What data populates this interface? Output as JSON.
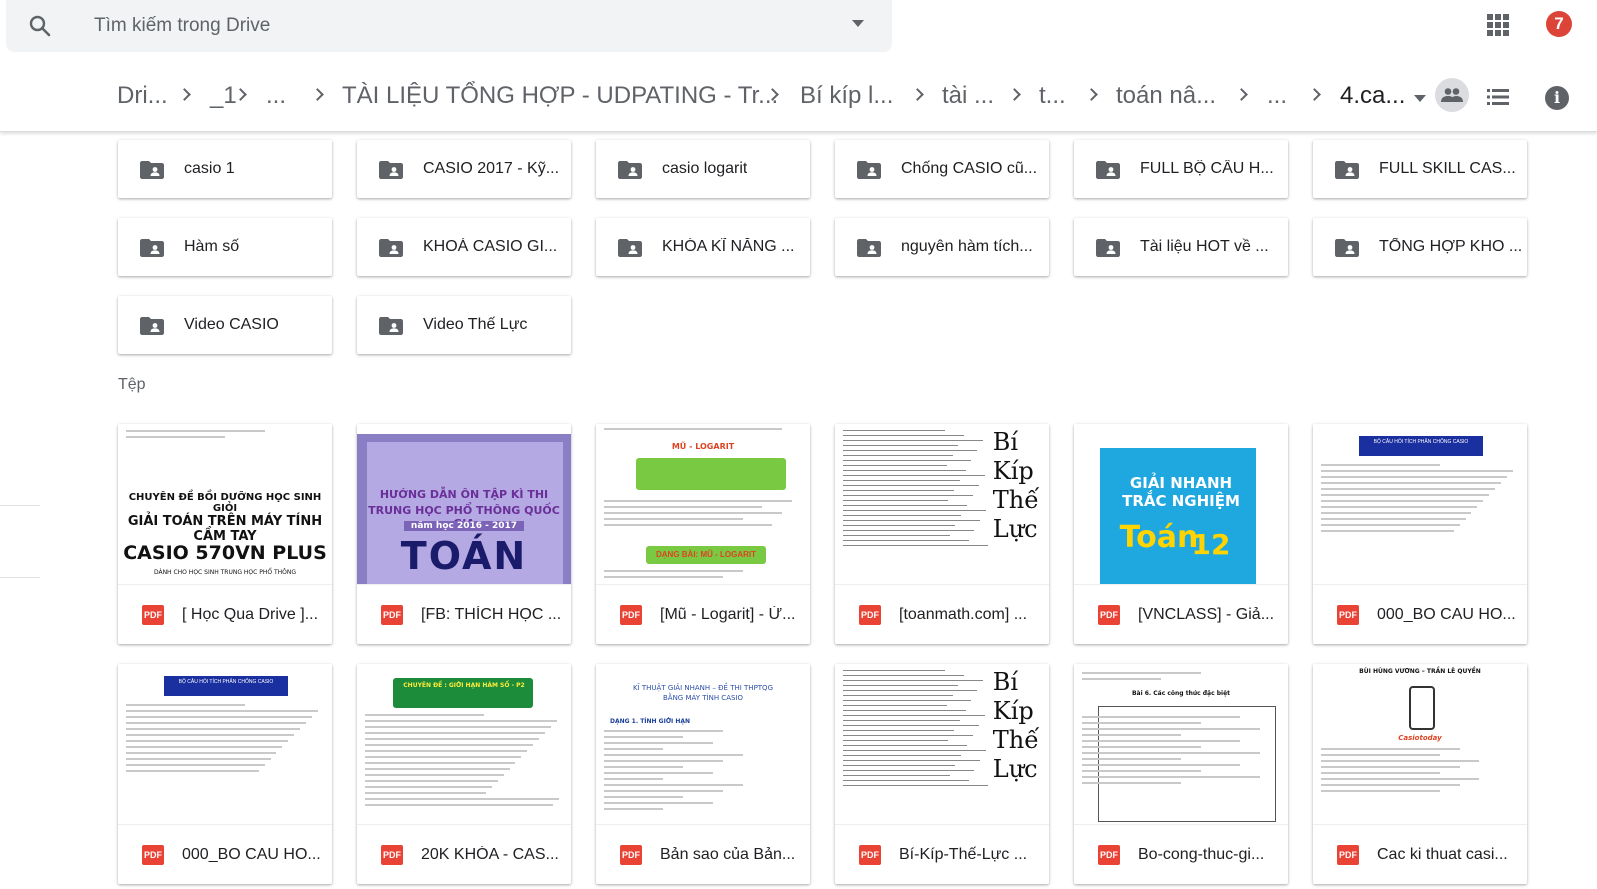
{
  "search": {
    "placeholder": "Tìm kiếm trong Drive"
  },
  "header": {
    "notification_count": "7"
  },
  "breadcrumb": {
    "items": [
      "Dri...",
      "_1",
      "...",
      "TÀI LIỆU TỔNG HỢP - UDPATING - Tr...",
      "Bí kíp l...",
      "tài ...",
      "t...",
      "toán nâ...",
      "...",
      "4.ca..."
    ]
  },
  "folders": [
    "casio 1",
    "CASIO 2017 - Kỹ...",
    "casio logarit",
    "Chống CASIO cũ...",
    "FULL BỘ CÂU H...",
    "FULL SKILL CAS...",
    "Hàm số",
    "KHOÁ CASIO GI...",
    "KHÓA KĨ NĂNG ...",
    "nguyên hàm tích...",
    "Tài liệu HOT về ...",
    "TỔNG HỢP KHO ...",
    "Video CASIO",
    "Video Thế Lực"
  ],
  "files_label": "Tệp",
  "file_type_label": "PDF",
  "files": [
    {
      "name": "[ Học Qua Drive ]...",
      "thumb": {
        "title1": "CHUYÊN ĐỀ BỒI DƯỠNG HỌC SINH GIỎI",
        "title2": "GIẢI TOÁN TRÊN MÁY TÍNH CẦM TAY",
        "title3": "CASIO 570VN PLUS",
        "sub": "DÀNH CHO HỌC SINH TRUNG HỌC PHỔ THÔNG"
      }
    },
    {
      "name": "[FB: THÍCH HỌC ...",
      "thumb": {
        "title1": "HƯỚNG DẪN ÔN TẬP KÌ THI",
        "title2": "TRUNG HỌC PHỔ THÔNG QUỐC GIA",
        "year": "năm học 2016 - 2017",
        "subject": "TOÁN"
      }
    },
    {
      "name": "[Mũ - Logarit] - Ứ...",
      "thumb": {
        "title1": "MŨ - LOGARIT",
        "title2": "DẠNG BÀI: MŨ - LOGARIT"
      }
    },
    {
      "name": "[toanmath.com] ...",
      "thumb": {
        "big": [
          "Bí",
          "Kíp",
          "Thế",
          "Lực"
        ]
      }
    },
    {
      "name": "[VNCLASS] - Giả...",
      "thumb": {
        "title1": "GIẢI NHANH",
        "title2": "TRẮC NGHIỆM",
        "title3": "Toán",
        "grade": "12"
      }
    },
    {
      "name": "000_BO CAU HO...",
      "thumb": {
        "title1": "BỘ CÂU HỎI TÍCH PHÂN CHỐNG CASIO"
      }
    },
    {
      "name": "000_BO CAU HO...",
      "thumb": {
        "title1": "BỘ CÂU HỎI TÍCH PHÂN CHỐNG CASIO"
      }
    },
    {
      "name": "20K KHÓA - CAS...",
      "thumb": {
        "title1": "CHUYÊN ĐỀ : GIỚI HẠN HÀM SỐ - P2"
      }
    },
    {
      "name": "Bản sao của Bản...",
      "thumb": {
        "title1": "KĨ THUẬT GIẢI NHANH – ĐỀ THI THPTQG",
        "title2": "BẰNG MÁY TÍNH CASIO",
        "title3": "DẠNG 1. TÍNH GIỚI HẠN"
      }
    },
    {
      "name": "Bí-Kíp-Thế-Lực ...",
      "thumb": {
        "big": [
          "Bí",
          "Kíp",
          "Thế",
          "Lực"
        ]
      }
    },
    {
      "name": "Bo-cong-thuc-gi...",
      "thumb": {
        "title1": "Bài 6. Các công thức đặc biệt"
      }
    },
    {
      "name": "Cac ki thuat casi...",
      "thumb": {
        "title1": "BÙI HÙNG VƯƠNG – TRẦN LÊ QUYỀN",
        "brand": "Casiotoday"
      }
    }
  ],
  "colors": {
    "pdf_red": "#e94335",
    "notif_red": "#db4437",
    "icon_gray": "#5f6368"
  }
}
